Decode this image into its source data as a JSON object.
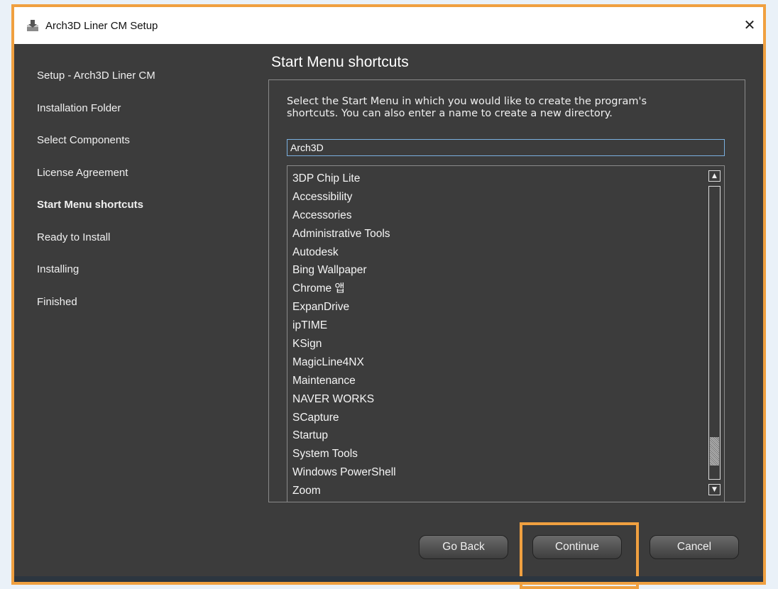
{
  "window": {
    "title": "Arch3D Liner CM Setup",
    "close_label": "✕"
  },
  "sidebar": {
    "items": [
      {
        "label": "Setup - Arch3D Liner CM"
      },
      {
        "label": "Installation Folder"
      },
      {
        "label": "Select Components"
      },
      {
        "label": "License Agreement"
      },
      {
        "label": "Start Menu shortcuts",
        "active": true
      },
      {
        "label": "Ready to Install"
      },
      {
        "label": "Installing"
      },
      {
        "label": "Finished"
      }
    ]
  },
  "page": {
    "title": "Start Menu shortcuts",
    "description_line1": "Select the Start Menu in which you would like to create the program's",
    "description_line2": "shortcuts. You can also enter a name to create a new directory."
  },
  "folder_input": {
    "value": "Arch3D"
  },
  "folder_list": {
    "items": [
      "3DP Chip Lite",
      "Accessibility",
      "Accessories",
      "Administrative Tools",
      "Autodesk",
      "Bing Wallpaper",
      "Chrome 앱",
      "ExpanDrive",
      "ipTIME",
      "KSign",
      "MagicLine4NX",
      "Maintenance",
      "NAVER WORKS",
      "SCapture",
      "Startup",
      "System Tools",
      "Windows PowerShell",
      "Zoom"
    ],
    "scroll_position": 0.95
  },
  "buttons": {
    "back": "Go Back",
    "continue": "Continue",
    "cancel": "Cancel"
  },
  "colors": {
    "background": "#3c3c3c",
    "highlight": "#f0a040"
  }
}
